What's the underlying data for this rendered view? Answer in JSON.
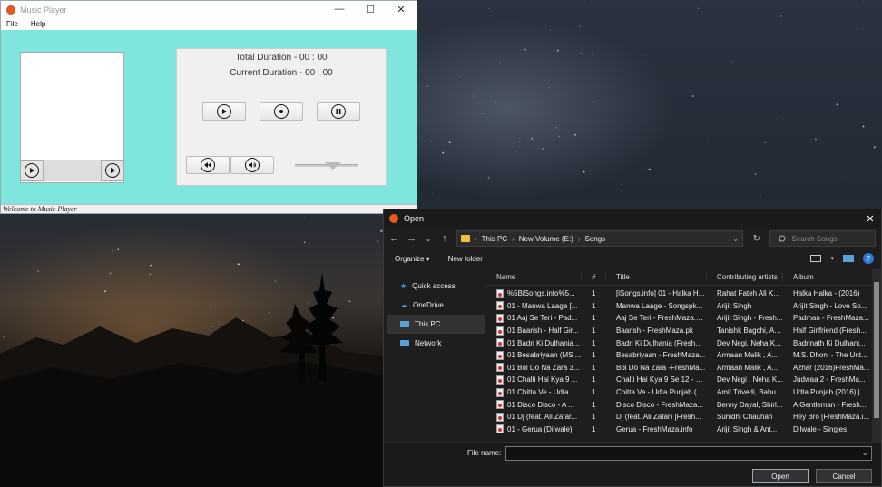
{
  "music_player": {
    "title": "Music Player",
    "menu": [
      "File",
      "Help"
    ],
    "total_duration": "Total Duration - 00 : 00",
    "current_duration": "Current Duration - 00 : 00",
    "status": "Welcome to Music Player",
    "window_controls": {
      "minimize": "—",
      "maximize": "☐",
      "close": "✕"
    }
  },
  "dialog": {
    "title": "Open",
    "close": "✕",
    "breadcrumb": [
      "This PC",
      "New Volume (E:)",
      "Songs"
    ],
    "search_placeholder": "Search Songs",
    "toolbar": {
      "organize": "Organize ▾",
      "new_folder": "New folder"
    },
    "nav_items": [
      "Quick access",
      "OneDrive",
      "This PC",
      "Network"
    ],
    "columns": [
      "Name",
      "#",
      "Title",
      "Contributing artists",
      "Album"
    ],
    "rows": [
      {
        "name": "%5BiSongs.info%5...",
        "num": "1",
        "title": "[iSongs.info] 01 - Halka H...",
        "artist": "Rahat Fateh Ali Kh...",
        "album": "Halka Halka - (2016)"
      },
      {
        "name": "01 - Manwa Laage [...",
        "num": "1",
        "title": "Manwa Laage - Songspk...",
        "artist": "Arijit Singh",
        "album": "Arijit Singh - Love So..."
      },
      {
        "name": "01 Aaj Se Teri - Pad...",
        "num": "1",
        "title": "Aaj Se Teri - FreshMaza.Net",
        "artist": "Arijit Singh - Fresh...",
        "album": "Padman - FreshMaza..."
      },
      {
        "name": "01 Baarish - Half Gir...",
        "num": "1",
        "title": "Baarish - FreshMaza.pk",
        "artist": "Tanishk Bagchi, As...",
        "album": "Half Girlfriend (Fresh..."
      },
      {
        "name": "01 Badri Ki Dulhania...",
        "num": "1",
        "title": "Badri Ki Dulhania (FreshM...",
        "artist": "Dev Negi, Neha K...",
        "album": "Badrinath Ki Dulhani..."
      },
      {
        "name": "01 Besabriyaan (MS ...",
        "num": "1",
        "title": "Besabriyaan - FreshMaza...",
        "artist": "Armaan Malik , A...",
        "album": "M.S. Dhoni - The Unt..."
      },
      {
        "name": "01 Bol Do Na Zara 3...",
        "num": "1",
        "title": "Bol Do Na Zara -FreshMa...",
        "artist": "Armaan Malik , A...",
        "album": "Azhar (2016)FreshMa..."
      },
      {
        "name": "01 Chalti Hai Kya 9 ...",
        "num": "1",
        "title": "Chalti Hai Kya 9 Se 12 - Fr...",
        "artist": "Dev Negi , Neha K...",
        "album": "Judwaa 2 - FreshMa..."
      },
      {
        "name": "01 Chitta Ve - Udta ...",
        "num": "1",
        "title": "Chitta Ve - Udta Punjab (...",
        "artist": "Amit Trivedi, Babu...",
        "album": "Udta Punjab (2016) | ..."
      },
      {
        "name": "01 Disco Disco - A ...",
        "num": "1",
        "title": "Disco Disco - FreshMaza...",
        "artist": "Benny Dayal, Shirl...",
        "album": "A Gentleman - Fresh..."
      },
      {
        "name": "01 Dj (feat. Ali Zafar...",
        "num": "1",
        "title": "Dj (feat. Ali Zafar) [Fresh...",
        "artist": "Sunidhi Chauhan",
        "album": "Hey Bro [FreshMaza.i..."
      },
      {
        "name": "01 - Gerua (Dilwale)",
        "num": "1",
        "title": "Gerua - FreshMaza.info",
        "artist": "Arijit Singh & Ant...",
        "album": "Dilwale - Singles"
      }
    ],
    "file_name_label": "File name:",
    "file_name_value": "",
    "open_label": "Open",
    "cancel_label": "Cancel"
  }
}
